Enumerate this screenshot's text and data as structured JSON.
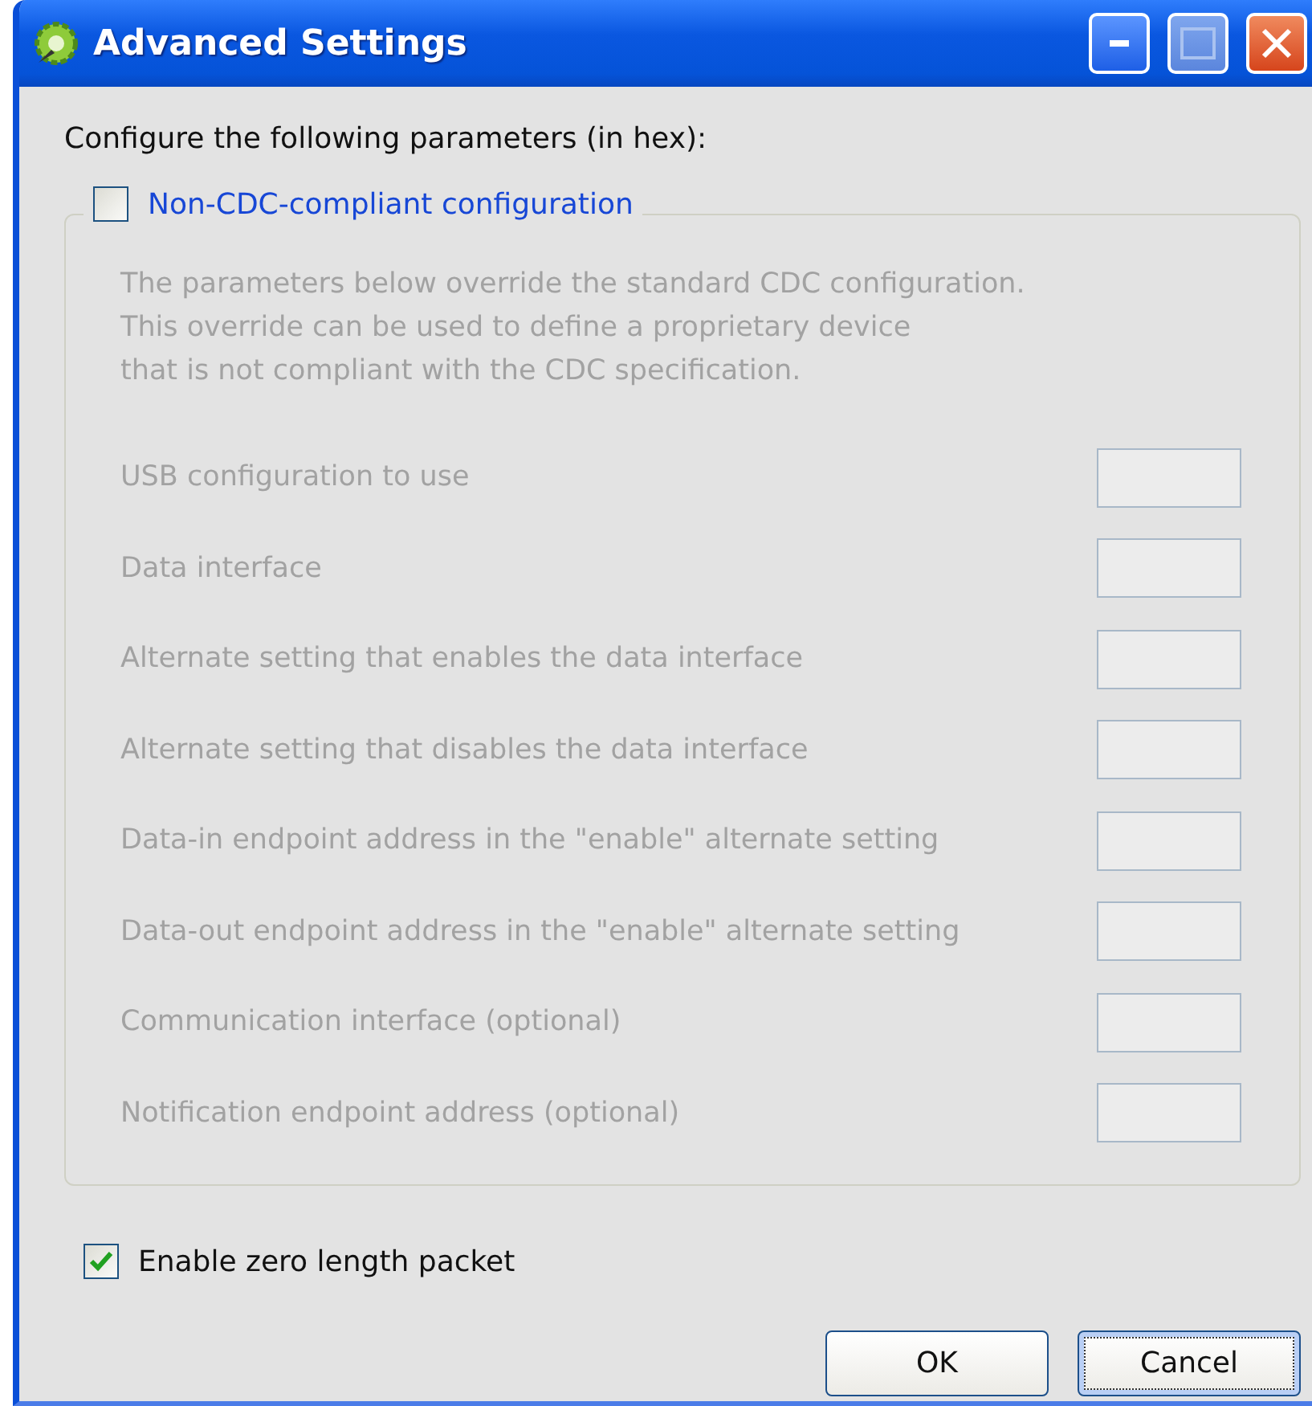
{
  "window": {
    "title": "Advanced Settings"
  },
  "intro": "Configure the following parameters (in hex):",
  "override": {
    "label": "Non-CDC-compliant configuration",
    "checked": false,
    "description": "The parameters below override the standard CDC configuration.\nThis override can be used to define a proprietary device\nthat is not compliant with the CDC specification.",
    "fields": [
      {
        "label": "USB configuration to use"
      },
      {
        "label": "Data interface"
      },
      {
        "label": "Alternate setting that enables the data interface"
      },
      {
        "label": "Alternate setting that disables the data interface"
      },
      {
        "label": "Data-in endpoint address in the \"enable\" alternate setting"
      },
      {
        "label": "Data-out endpoint address in the \"enable\" alternate setting"
      },
      {
        "label": "Communication interface (optional)"
      },
      {
        "label": "Notification endpoint address (optional)"
      }
    ]
  },
  "zero_length": {
    "label": "Enable zero length packet",
    "checked": true
  },
  "buttons": [
    {
      "label": "OK",
      "focused": false
    },
    {
      "label": "Cancel",
      "focused": true
    }
  ]
}
